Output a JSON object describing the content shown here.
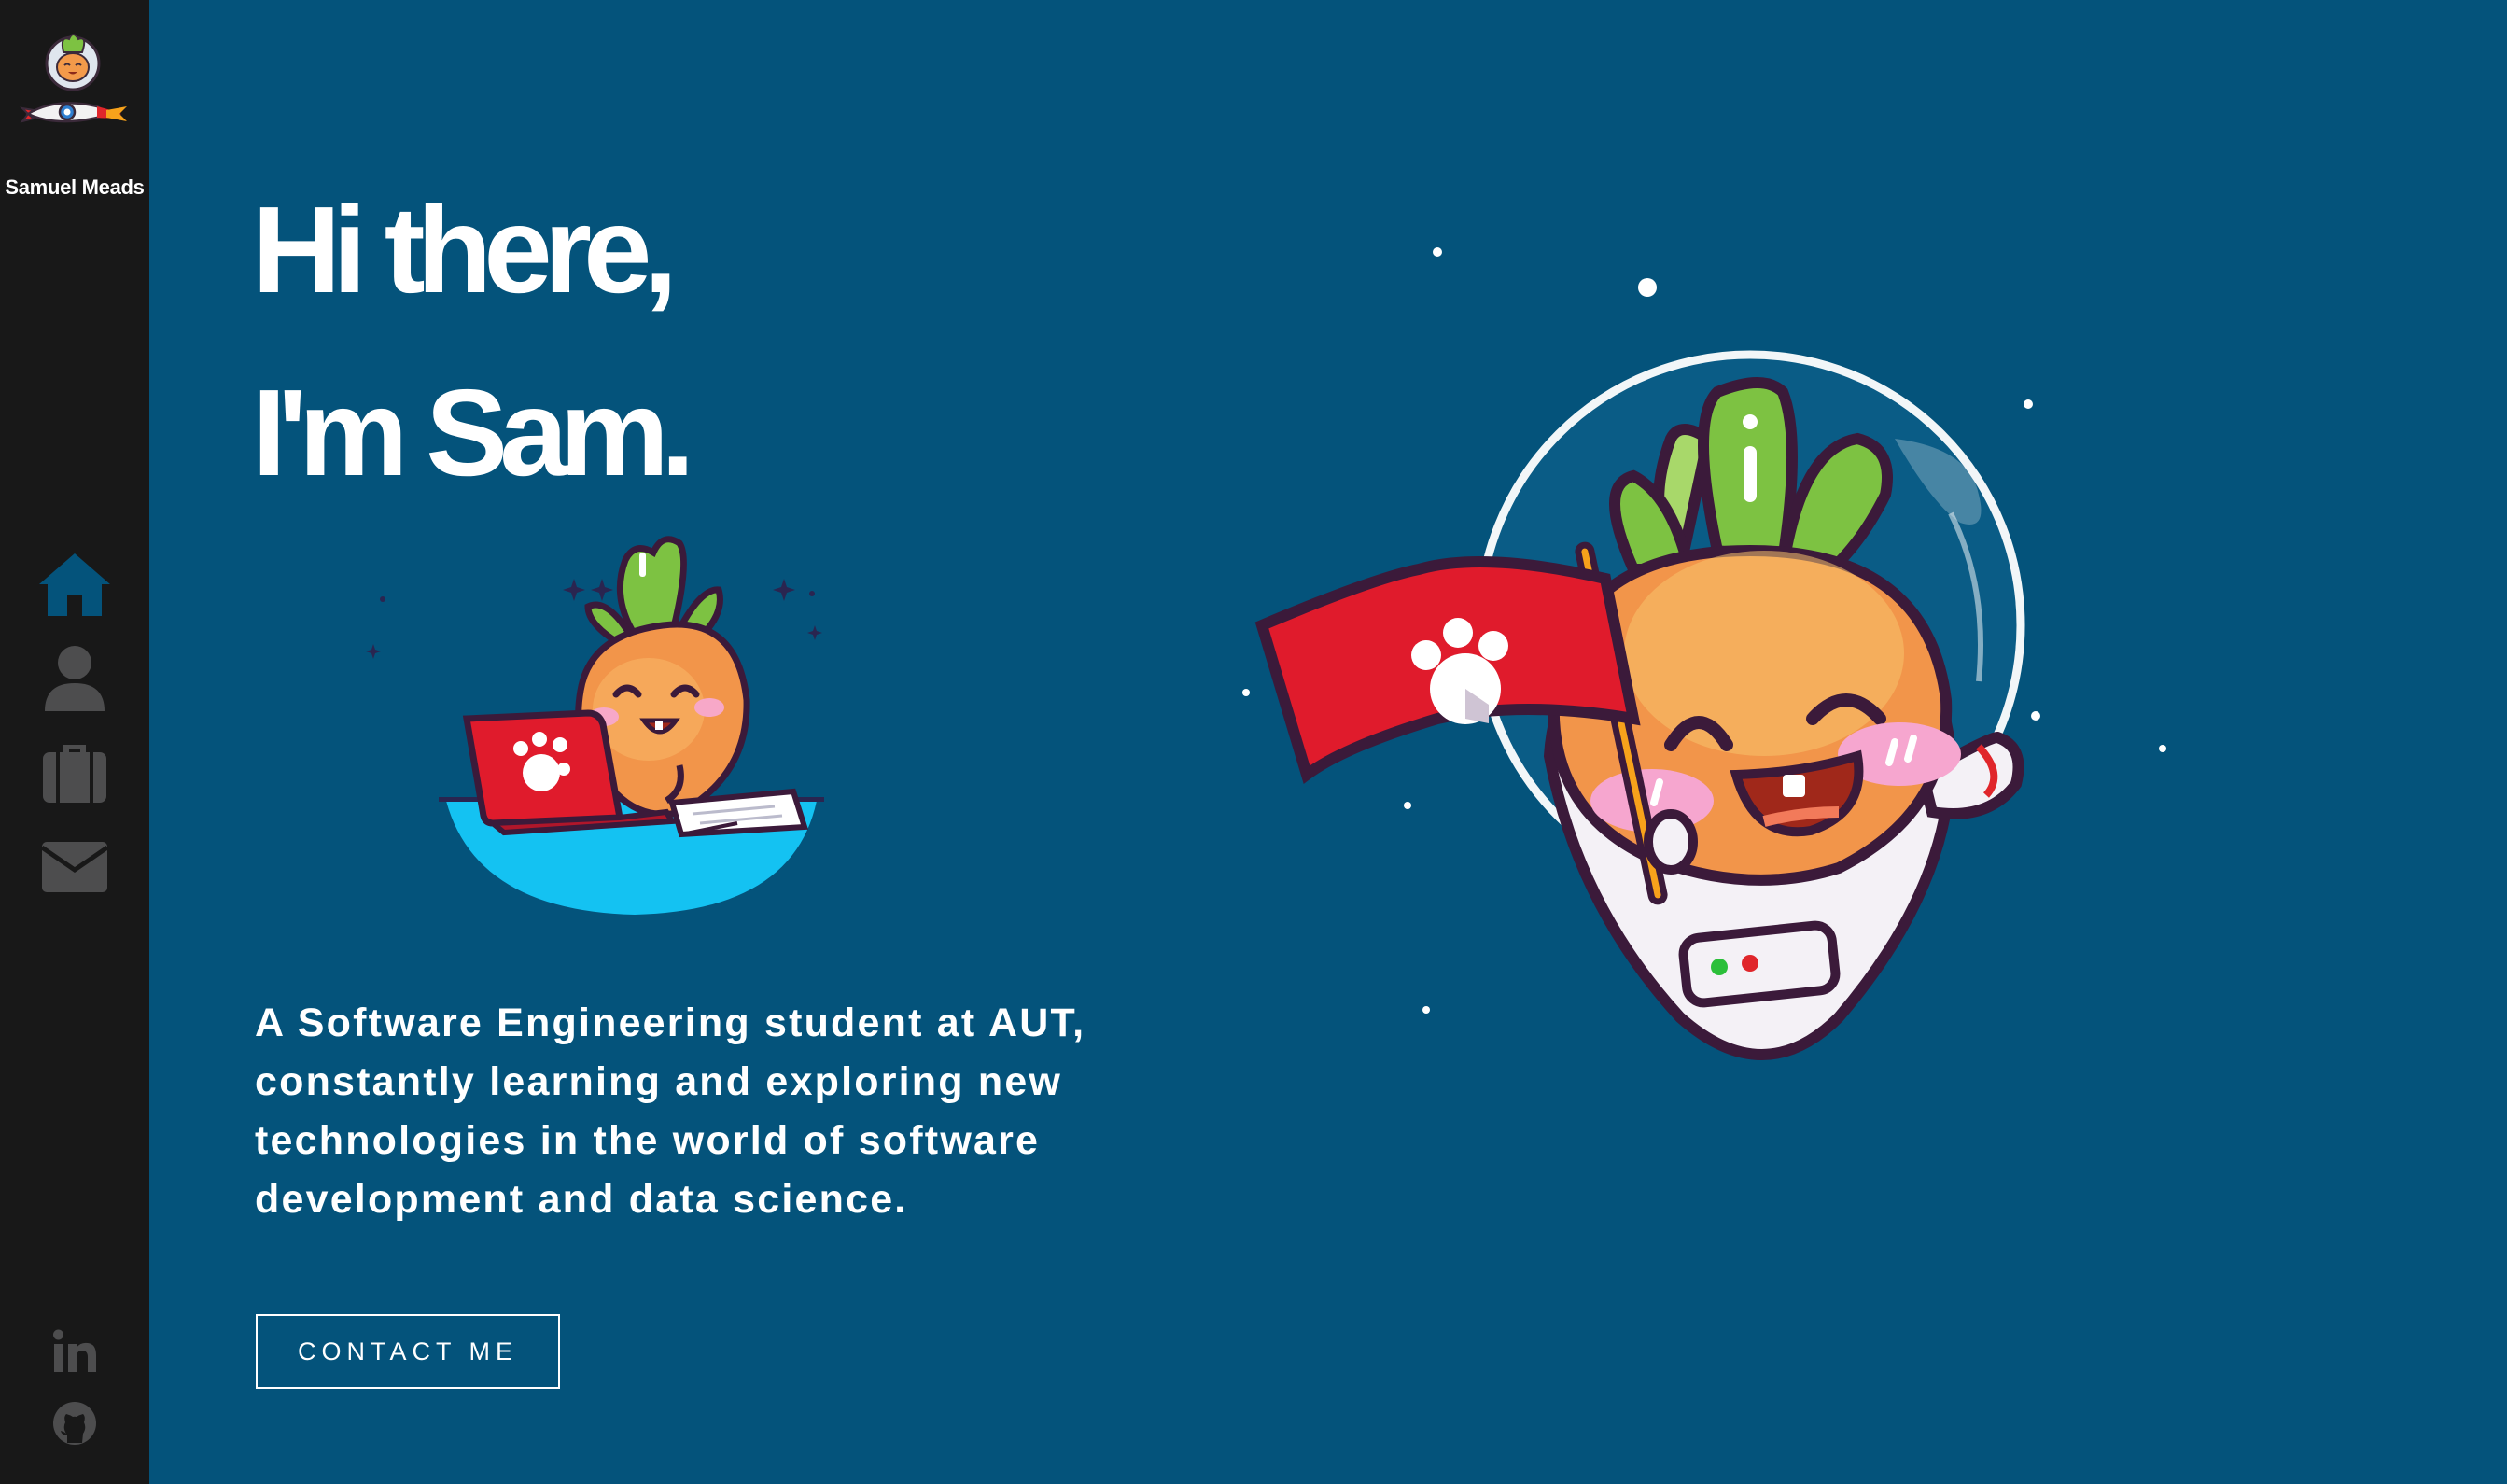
{
  "sidebar": {
    "brand_name": "Samuel Meads",
    "nav": [
      {
        "name": "home",
        "icon": "home-icon",
        "active": true
      },
      {
        "name": "about",
        "icon": "user-icon",
        "active": false
      },
      {
        "name": "portfolio",
        "icon": "briefcase-icon",
        "active": false
      },
      {
        "name": "contact",
        "icon": "envelope-icon",
        "active": false
      }
    ],
    "social": [
      {
        "name": "linkedin",
        "icon": "linkedin-icon"
      },
      {
        "name": "github",
        "icon": "github-icon"
      }
    ],
    "active_color": "#04537b",
    "inactive_color": "#4d4d4e"
  },
  "hero": {
    "title_line1": "Hi there,",
    "title_line2": "I'm Sam.",
    "description": "A Software Engineering student at AUT, constantly learning and exploring new technologies in the world of software development and data science.",
    "contact_button": "CONTACT ME"
  },
  "colors": {
    "background": "#04537b",
    "sidebar": "#181818",
    "text": "#ffffff"
  }
}
